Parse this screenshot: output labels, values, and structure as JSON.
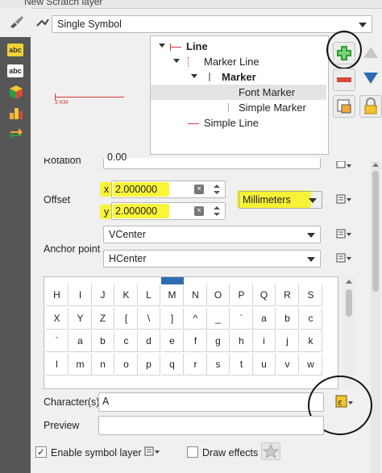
{
  "window": {
    "title": "New Scratch layer"
  },
  "symbol_type": {
    "value": "Single Symbol"
  },
  "preview": {
    "scale_label": "3 KM"
  },
  "tree": [
    {
      "label": "Line",
      "bold": true,
      "level": 0
    },
    {
      "label": "Marker Line",
      "bold": false,
      "level": 1
    },
    {
      "label": "Marker",
      "bold": true,
      "level": 2
    },
    {
      "label": "Font Marker",
      "bold": false,
      "level": 3,
      "selected": true
    },
    {
      "label": "Simple Marker",
      "bold": false,
      "level": 3
    },
    {
      "label": "Simple Line",
      "bold": false,
      "level": 1
    }
  ],
  "props": {
    "rotation_label": "Rotation",
    "rotation_value": "0.00",
    "offset_label": "Offset",
    "x_label": "x",
    "x_value": "2.000000",
    "y_label": "y",
    "y_value": "2.000000",
    "unit_value": "Millimeters",
    "anchor_label": "Anchor point",
    "anchor_v": "VCenter",
    "anchor_h": "HCenter"
  },
  "charmap": {
    "rows": [
      [
        "H",
        "I",
        "J",
        "K",
        "L",
        "M",
        "N",
        "O",
        "P",
        "Q",
        "R",
        "S"
      ],
      [
        "X",
        "Y",
        "Z",
        "[",
        "\\",
        "]",
        "^",
        "_",
        "`",
        "a",
        "b",
        "c"
      ],
      [
        "`",
        "a",
        "b",
        "c",
        "d",
        "e",
        "f",
        "g",
        "h",
        "i",
        "j",
        "k"
      ],
      [
        "l",
        "m",
        "n",
        "o",
        "p",
        "q",
        "r",
        "s",
        "t",
        "u",
        "v",
        "w"
      ]
    ]
  },
  "character": {
    "label": "Character(s)",
    "value": "A"
  },
  "preview_field": {
    "label": "Preview",
    "value": ""
  },
  "enable_layer": {
    "label": "Enable symbol layer",
    "checked": true
  },
  "draw_effects": {
    "label": "Draw effects",
    "checked": false
  },
  "colors": {
    "highlight": "#f7f200",
    "accent_blue": "#2f6db3",
    "add_green": "#2e9e2e",
    "remove_red": "#d9463e",
    "line_red": "#d23c3c"
  },
  "icons": [
    "brush-icon",
    "abc-label-icon",
    "abc-icon",
    "cube-icon",
    "diagram-icon",
    "arrows-icon",
    "add-layer-icon",
    "remove-layer-icon",
    "up-arrow-icon",
    "down-arrow-icon",
    "duplicate-layer-icon",
    "lock-icon",
    "data-defined-icon",
    "star-icon"
  ]
}
